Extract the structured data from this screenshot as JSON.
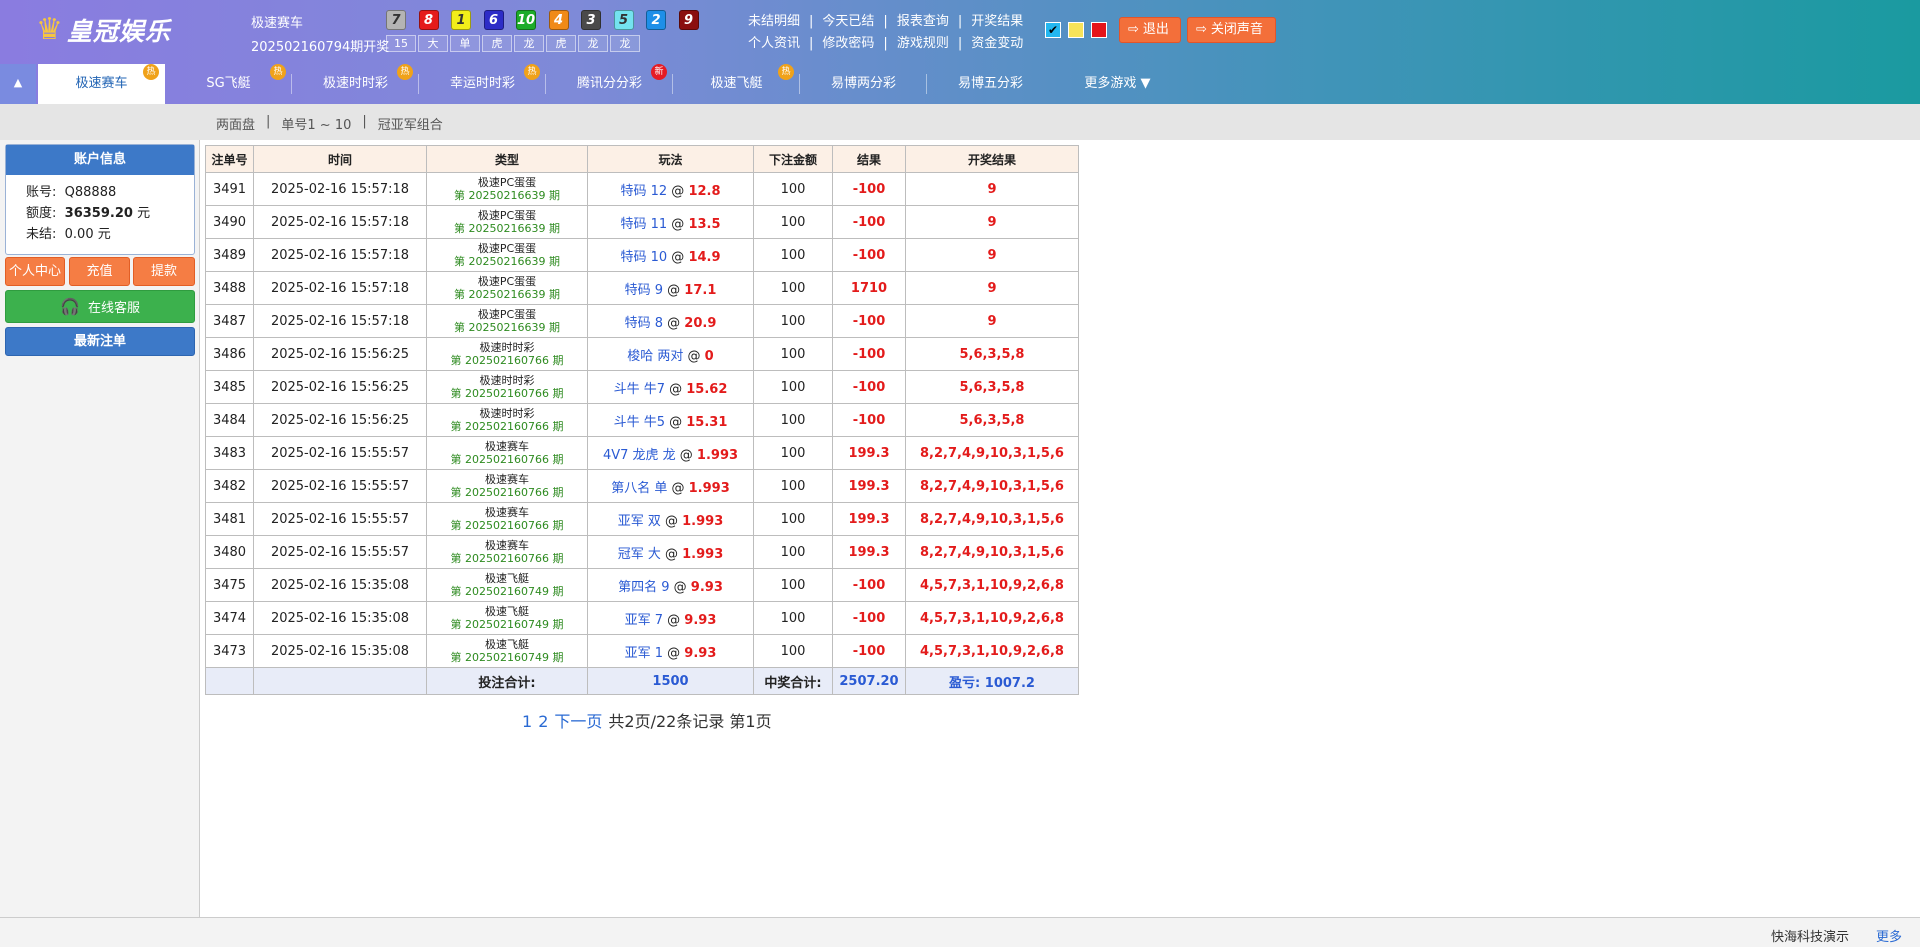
{
  "brand": {
    "name": "皇冠娱乐"
  },
  "lottery": {
    "name": "极速赛车",
    "issue": "202502160794期开奖",
    "balls": [
      {
        "n": "7",
        "color": "#b4b4b4",
        "fg": "#333"
      },
      {
        "n": "8",
        "color": "#e51b1b",
        "fg": "#fff"
      },
      {
        "n": "1",
        "color": "#f2ee1a",
        "fg": "#333"
      },
      {
        "n": "6",
        "color": "#2d2cc7",
        "fg": "#fff"
      },
      {
        "n": "10",
        "color": "#1cac2a",
        "fg": "#fff"
      },
      {
        "n": "4",
        "color": "#f08a18",
        "fg": "#fff"
      },
      {
        "n": "3",
        "color": "#4a4a4a",
        "fg": "#fff"
      },
      {
        "n": "5",
        "color": "#74e3ef",
        "fg": "#333"
      },
      {
        "n": "2",
        "color": "#1e8fe8",
        "fg": "#fff"
      },
      {
        "n": "9",
        "color": "#8b0f0f",
        "fg": "#fff"
      }
    ],
    "sums": [
      "15",
      "大",
      "单",
      "虎",
      "龙",
      "虎",
      "龙",
      "龙"
    ]
  },
  "toplinks": {
    "row1": [
      "未结明细",
      "今天已结",
      "报表查询",
      "开奖结果"
    ],
    "row2": [
      "个人资讯",
      "修改密码",
      "游戏规则",
      "资金变动"
    ]
  },
  "buttons": {
    "logout": "退出",
    "sound": "关闭声音"
  },
  "nav": {
    "tabs": [
      {
        "label": "极速赛车",
        "badge": "热",
        "type": "hot",
        "active": true
      },
      {
        "label": "SG飞艇",
        "badge": "热",
        "type": "hot"
      },
      {
        "label": "极速时时彩",
        "badge": "热",
        "type": "hot"
      },
      {
        "label": "幸运时时彩",
        "badge": "热",
        "type": "hot"
      },
      {
        "label": "腾讯分分彩",
        "badge": "新",
        "type": "new"
      },
      {
        "label": "极速飞艇",
        "badge": "热",
        "type": "hot"
      },
      {
        "label": "易博两分彩"
      },
      {
        "label": "易博五分彩"
      },
      {
        "label": "更多游戏 ▼"
      }
    ]
  },
  "subnav": [
    "两面盘",
    "单号1 ~ 10",
    "冠亚军组合"
  ],
  "account": {
    "title": "账户信息",
    "account_label": "账号:",
    "account": "Q88888",
    "credit_label": "额度:",
    "credit": "36359.20",
    "credit_unit": "元",
    "unsettled_label": "未结:",
    "unsettled": "0.00 元"
  },
  "side_buttons": {
    "center": "个人中心",
    "recharge": "充值",
    "withdraw": "提款",
    "service": "在线客服",
    "recent": "最新注单"
  },
  "table": {
    "headers": [
      "注单号",
      "时间",
      "类型",
      "玩法",
      "下注金额",
      "结果",
      "开奖结果"
    ],
    "rows": [
      {
        "id": "3491",
        "time": "2025-02-16 15:57:18",
        "type": "极速PC蛋蛋",
        "issue": "第 20250216639 期",
        "play": "特码 12",
        "odds": "12.8",
        "amount": "100",
        "result": "-100",
        "draw": "9"
      },
      {
        "id": "3490",
        "time": "2025-02-16 15:57:18",
        "type": "极速PC蛋蛋",
        "issue": "第 20250216639 期",
        "play": "特码 11",
        "odds": "13.5",
        "amount": "100",
        "result": "-100",
        "draw": "9"
      },
      {
        "id": "3489",
        "time": "2025-02-16 15:57:18",
        "type": "极速PC蛋蛋",
        "issue": "第 20250216639 期",
        "play": "特码 10",
        "odds": "14.9",
        "amount": "100",
        "result": "-100",
        "draw": "9"
      },
      {
        "id": "3488",
        "time": "2025-02-16 15:57:18",
        "type": "极速PC蛋蛋",
        "issue": "第 20250216639 期",
        "play": "特码 9",
        "odds": "17.1",
        "amount": "100",
        "result": "1710",
        "draw": "9"
      },
      {
        "id": "3487",
        "time": "2025-02-16 15:57:18",
        "type": "极速PC蛋蛋",
        "issue": "第 20250216639 期",
        "play": "特码 8",
        "odds": "20.9",
        "amount": "100",
        "result": "-100",
        "draw": "9"
      },
      {
        "id": "3486",
        "time": "2025-02-16 15:56:25",
        "type": "极速时时彩",
        "issue": "第 202502160766 期",
        "play": "梭哈 两对",
        "odds": "0",
        "amount": "100",
        "result": "-100",
        "draw": "5,6,3,5,8"
      },
      {
        "id": "3485",
        "time": "2025-02-16 15:56:25",
        "type": "极速时时彩",
        "issue": "第 202502160766 期",
        "play": "斗牛 牛7",
        "odds": "15.62",
        "amount": "100",
        "result": "-100",
        "draw": "5,6,3,5,8"
      },
      {
        "id": "3484",
        "time": "2025-02-16 15:56:25",
        "type": "极速时时彩",
        "issue": "第 202502160766 期",
        "play": "斗牛 牛5",
        "odds": "15.31",
        "amount": "100",
        "result": "-100",
        "draw": "5,6,3,5,8"
      },
      {
        "id": "3483",
        "time": "2025-02-16 15:55:57",
        "type": "极速赛车",
        "issue": "第 202502160766 期",
        "play": "4V7 龙虎 龙",
        "odds": "1.993",
        "amount": "100",
        "result": "199.3",
        "draw": "8,2,7,4,9,10,3,1,5,6"
      },
      {
        "id": "3482",
        "time": "2025-02-16 15:55:57",
        "type": "极速赛车",
        "issue": "第 202502160766 期",
        "play": "第八名 单",
        "odds": "1.993",
        "amount": "100",
        "result": "199.3",
        "draw": "8,2,7,4,9,10,3,1,5,6"
      },
      {
        "id": "3481",
        "time": "2025-02-16 15:55:57",
        "type": "极速赛车",
        "issue": "第 202502160766 期",
        "play": "亚军 双",
        "odds": "1.993",
        "amount": "100",
        "result": "199.3",
        "draw": "8,2,7,4,9,10,3,1,5,6"
      },
      {
        "id": "3480",
        "time": "2025-02-16 15:55:57",
        "type": "极速赛车",
        "issue": "第 202502160766 期",
        "play": "冠军 大",
        "odds": "1.993",
        "amount": "100",
        "result": "199.3",
        "draw": "8,2,7,4,9,10,3,1,5,6"
      },
      {
        "id": "3475",
        "time": "2025-02-16 15:35:08",
        "type": "极速飞艇",
        "issue": "第 202502160749 期",
        "play": "第四名 9",
        "odds": "9.93",
        "amount": "100",
        "result": "-100",
        "draw": "4,5,7,3,1,10,9,2,6,8"
      },
      {
        "id": "3474",
        "time": "2025-02-16 15:35:08",
        "type": "极速飞艇",
        "issue": "第 202502160749 期",
        "play": "亚军 7",
        "odds": "9.93",
        "amount": "100",
        "result": "-100",
        "draw": "4,5,7,3,1,10,9,2,6,8"
      },
      {
        "id": "3473",
        "time": "2025-02-16 15:35:08",
        "type": "极速飞艇",
        "issue": "第 202502160749 期",
        "play": "亚军 1",
        "odds": "9.93",
        "amount": "100",
        "result": "-100",
        "draw": "4,5,7,3,1,10,9,2,6,8"
      }
    ],
    "totals": {
      "bet_label": "投注合计:",
      "bet_total": "1500",
      "win_label": "中奖合计:",
      "win_total": "2507.20",
      "profit": "盈亏:  1007.2"
    }
  },
  "pager": {
    "p1": "1",
    "p2": "2",
    "next": "下一页",
    "info": "共2页/22条记录 第1页"
  },
  "footer": {
    "ticker": "快海科技演示",
    "more": "更多"
  }
}
